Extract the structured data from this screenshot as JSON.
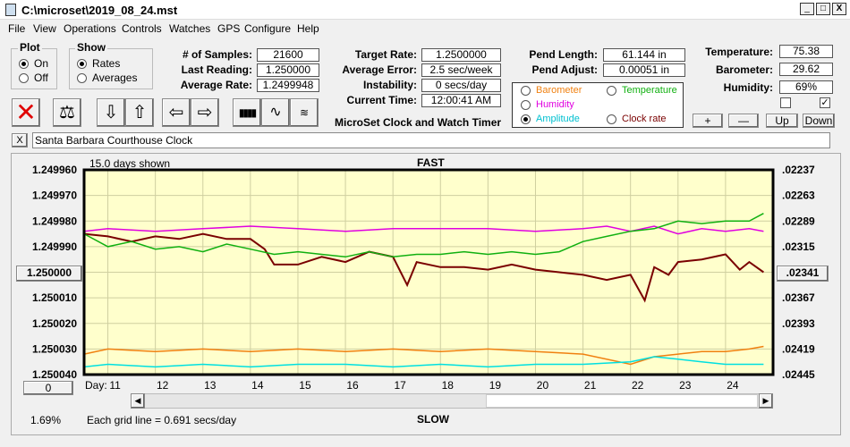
{
  "window": {
    "title": "C:\\microset\\2019_08_24.mst",
    "min": "_",
    "max": "□",
    "close": "X"
  },
  "menu": [
    "File",
    "View",
    "Operations",
    "Controls",
    "Watches",
    "GPS",
    "Configure",
    "Help"
  ],
  "plot": {
    "label": "Plot",
    "on": "On",
    "off": "Off"
  },
  "show": {
    "label": "Show",
    "rates": "Rates",
    "averages": "Averages"
  },
  "stats": {
    "samples_label": "# of Samples:",
    "samples": "21600",
    "last_label": "Last Reading:",
    "last": "1.250000",
    "avg_label": "Average Rate:",
    "avg": "1.2499948",
    "target_label": "Target Rate:",
    "target": "1.2500000",
    "avgerr_label": "Average Error:",
    "avgerr": "2.5 sec/week",
    "instab_label": "Instability:",
    "instab": "0 secs/day",
    "time_label": "Current Time:",
    "time": "12:00:41 AM",
    "pendlen_label": "Pend Length:",
    "pendlen": "61.144 in",
    "pendadj_label": "Pend Adjust:",
    "pendadj": "0.00051 in",
    "temp_label": "Temperature:",
    "temp": "75.38",
    "baro_label": "Barometer:",
    "baro": "29.62",
    "hum_label": "Humidity:",
    "hum": "69%"
  },
  "app_caption": "MicroSet Clock and Watch Timer",
  "series_select": {
    "barometer": "Barometer",
    "temperature": "Temperature",
    "humidity": "Humidity",
    "amplitude": "Amplitude",
    "clockrate": "Clock rate"
  },
  "sensor_buttons": {
    "plus": "+",
    "minus": "—",
    "up": "Up",
    "down": "Down"
  },
  "checks": {
    "left": "",
    "right": "✓"
  },
  "watch_name": "Santa Barbara Courthouse Clock",
  "watch_close": "X",
  "chart_header": {
    "days_shown": "15.0 days shown",
    "fast": "FAST",
    "slow": "SLOW",
    "grid_note": "Each grid line = 0.691 secs/day",
    "percent": "1.69%",
    "zero_btn": "0",
    "day_label": "Day:"
  },
  "colors": {
    "rate": "#7a0000",
    "humidity": "#e000e0",
    "temperature": "#10b010",
    "barometer": "#f08010",
    "amplitude": "#00e0e0",
    "plot_bg": "#ffffcc"
  },
  "chart_data": {
    "type": "line",
    "x_range": [
      10.5,
      25
    ],
    "left_ticks": [
      "1.249960",
      "1.249970",
      "1.249980",
      "1.249990",
      "1.250000",
      "1.250010",
      "1.250020",
      "1.250030",
      "1.250040"
    ],
    "right_ticks": [
      ".02237",
      ".02263",
      ".02289",
      ".02315",
      ".02341",
      ".02367",
      ".02393",
      ".02419",
      ".02445"
    ],
    "left_center_btn": "1.250000",
    "right_center_btn": ".02341",
    "x_ticks": [
      "11",
      "12",
      "13",
      "14",
      "15",
      "16",
      "17",
      "18",
      "19",
      "20",
      "21",
      "22",
      "23",
      "24"
    ],
    "series": [
      {
        "name": "Clock rate",
        "color": "#7a0000",
        "x": [
          10.5,
          11,
          11.5,
          12,
          12.5,
          13,
          13.5,
          14,
          14.3,
          14.5,
          15,
          15.5,
          16,
          16.5,
          17,
          17.3,
          17.5,
          18,
          18.5,
          19,
          19.5,
          20,
          20.5,
          21,
          21.5,
          22,
          22.3,
          22.5,
          22.8,
          23,
          23.5,
          24,
          24.3,
          24.5,
          24.8
        ],
        "y": [
          1.249985,
          1.249986,
          1.249988,
          1.249986,
          1.249987,
          1.249985,
          1.249987,
          1.249987,
          1.249991,
          1.249997,
          1.249997,
          1.249994,
          1.249996,
          1.249992,
          1.249994,
          1.250005,
          1.249996,
          1.249998,
          1.249998,
          1.249999,
          1.249997,
          1.249999,
          1.25,
          1.250001,
          1.250003,
          1.250001,
          1.250011,
          1.249998,
          1.250001,
          1.249996,
          1.249995,
          1.249993,
          1.249999,
          1.249996,
          1.25
        ]
      },
      {
        "name": "Humidity",
        "color": "#e000e0",
        "x": [
          10.5,
          11,
          12,
          13,
          14,
          15,
          16,
          17,
          18,
          19,
          20,
          21,
          21.5,
          22,
          22.5,
          23,
          23.5,
          24,
          24.5,
          24.8
        ],
        "y": [
          1.249984,
          1.249983,
          1.249984,
          1.249983,
          1.249982,
          1.249983,
          1.249984,
          1.249983,
          1.249983,
          1.249983,
          1.249984,
          1.249983,
          1.249982,
          1.249984,
          1.249982,
          1.249985,
          1.249983,
          1.249984,
          1.249983,
          1.249984
        ]
      },
      {
        "name": "Temperature",
        "color": "#10b010",
        "x": [
          10.5,
          11,
          11.5,
          12,
          12.5,
          13,
          13.5,
          14,
          14.5,
          15,
          15.5,
          16,
          16.5,
          17,
          17.5,
          18,
          18.5,
          19,
          19.5,
          20,
          20.5,
          21,
          21.5,
          22,
          22.5,
          23,
          23.5,
          24,
          24.5,
          24.8
        ],
        "y": [
          1.249985,
          1.24999,
          1.249988,
          1.249991,
          1.24999,
          1.249992,
          1.249989,
          1.249991,
          1.249993,
          1.249992,
          1.249993,
          1.249994,
          1.249992,
          1.249994,
          1.249993,
          1.249993,
          1.249992,
          1.249993,
          1.249992,
          1.249993,
          1.249992,
          1.249988,
          1.249986,
          1.249984,
          1.249983,
          1.24998,
          1.249981,
          1.24998,
          1.24998,
          1.249977
        ]
      },
      {
        "name": "Barometer",
        "color": "#f08010",
        "x": [
          10.5,
          11,
          12,
          13,
          14,
          15,
          16,
          17,
          18,
          19,
          20,
          21,
          22,
          22.5,
          23,
          23.5,
          24,
          24.5,
          24.8
        ],
        "y": [
          1.250032,
          1.25003,
          1.250031,
          1.25003,
          1.250031,
          1.25003,
          1.250031,
          1.25003,
          1.250031,
          1.25003,
          1.250031,
          1.250032,
          1.250036,
          1.250033,
          1.250032,
          1.250031,
          1.250031,
          1.25003,
          1.250029
        ]
      },
      {
        "name": "Amplitude",
        "color": "#00e0e0",
        "x": [
          10.5,
          11,
          12,
          13,
          14,
          15,
          16,
          17,
          18,
          19,
          20,
          21,
          22,
          22.5,
          23,
          23.5,
          24,
          24.5,
          24.8
        ],
        "y": [
          1.250037,
          1.250036,
          1.250037,
          1.250036,
          1.250037,
          1.250036,
          1.250036,
          1.250037,
          1.250036,
          1.250037,
          1.250036,
          1.250036,
          1.250035,
          1.250033,
          1.250034,
          1.250035,
          1.250036,
          1.250036,
          1.250036
        ]
      }
    ],
    "ylim": [
      1.24996,
      1.25004
    ]
  }
}
